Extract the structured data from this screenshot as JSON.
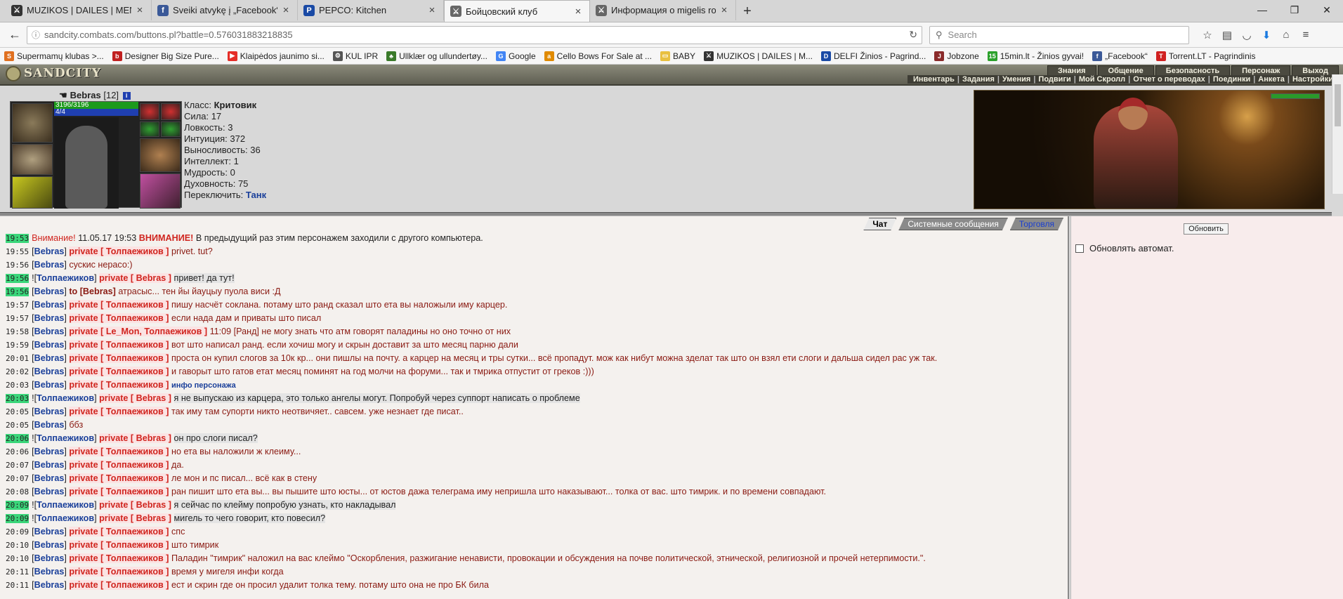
{
  "browser": {
    "tabs": [
      {
        "title": "MUZIKOS | DAILES | MENO |",
        "color": "#333333",
        "glyph": "⚔"
      },
      {
        "title": "Sveiki atvykę į „Facebook“ -",
        "color": "#3b5998",
        "glyph": "f"
      },
      {
        "title": "PEPCO: Kitchen",
        "color": "#1a4aa5",
        "glyph": "P"
      },
      {
        "title": "Бойцовский клуб",
        "color": "#666666",
        "glyph": "⚔"
      },
      {
        "title": "Информация о migelis role",
        "color": "#666666",
        "glyph": "⚔"
      }
    ],
    "url": "sandcity.combats.com/buttons.pl?battle=0.576031883218835",
    "search_placeholder": "Search",
    "bookmarks": [
      {
        "label": "Supermamų klubas >...",
        "color": "#e07020",
        "glyph": "S"
      },
      {
        "label": "Designer Big Size Pure...",
        "color": "#c02020",
        "glyph": "b"
      },
      {
        "label": "Klaipėdos jaunimo si...",
        "color": "#e52d27",
        "glyph": "▶"
      },
      {
        "label": "KUL IPR",
        "color": "#555555",
        "glyph": "⚙"
      },
      {
        "label": "Ullklær og ullundertøy...",
        "color": "#3a7a2a",
        "glyph": "♣"
      },
      {
        "label": "Google",
        "color": "#4285f4",
        "glyph": "G"
      },
      {
        "label": "Cello Bows For Sale at ...",
        "color": "#e08a00",
        "glyph": "a"
      },
      {
        "label": "BABY",
        "color": "#e8c040",
        "glyph": "▭"
      },
      {
        "label": "MUZIKOS | DAILES | M...",
        "color": "#333333",
        "glyph": "⚔"
      },
      {
        "label": "DELFI Žinios - Pagrind...",
        "color": "#1a4aa5",
        "glyph": "D"
      },
      {
        "label": "Jobzone",
        "color": "#8a2a2a",
        "glyph": "J"
      },
      {
        "label": "15min.lt - Žinios gyvai!",
        "color": "#2aa02a",
        "glyph": "15"
      },
      {
        "label": "„Facebook“",
        "color": "#3b5998",
        "glyph": "f"
      },
      {
        "label": "Torrent.LT - Pagrindinis",
        "color": "#d02020",
        "glyph": "T"
      }
    ]
  },
  "game": {
    "logo": "SANDCITY",
    "menu": [
      "Знания",
      "Общение",
      "Безопасность",
      "Персонаж",
      "Выход"
    ],
    "submenu": [
      "Инвентарь",
      "Задания",
      "Умения",
      "Подвиги",
      "Мой Скролл",
      "Отчет о переводах",
      "Поединки",
      "Анкета",
      "Настройки"
    ],
    "character": {
      "name": "Bebras",
      "level": "[12]",
      "hp": "3196/3196",
      "mana": "4/4",
      "class_label": "Класс:",
      "class_value": "Критовик",
      "stats": [
        {
          "label": "Сила:",
          "value": "17"
        },
        {
          "label": "Ловкость:",
          "value": "3"
        },
        {
          "label": "Интуиция:",
          "value": "372"
        },
        {
          "label": "Выносливость:",
          "value": "36"
        },
        {
          "label": "Интеллект:",
          "value": "1"
        },
        {
          "label": "Мудрость:",
          "value": "0"
        },
        {
          "label": "Духовность:",
          "value": "75"
        }
      ],
      "switch_label": "Переключить:",
      "switch_value": "Танк"
    },
    "chat_tabs": [
      "Чат",
      "Системные сообщения",
      "Торговля"
    ],
    "side": {
      "refresh": "Обновить",
      "auto_refresh": "Обновлять автомат."
    },
    "chat": [
      {
        "time": "19:53",
        "hl": true,
        "prefix": "",
        "sender": "",
        "channel": "",
        "warning": true,
        "text": "11.05.17 19:53",
        "bold": "ВНИМАНИЕ!",
        "rest": "В предыдущий раз этим персонажем заходили с другого компьютера.",
        "label": "Внимание!"
      },
      {
        "time": "19:55",
        "hl": false,
        "prefix": "",
        "sender": "Bebras",
        "channel": "private [ Толпаежиков ]",
        "text": "privet. tut?"
      },
      {
        "time": "19:56",
        "hl": false,
        "prefix": "",
        "sender": "Bebras",
        "channel": "",
        "text": "сускис нерасо:)"
      },
      {
        "time": "19:56",
        "hl": true,
        "prefix": "!",
        "sender": "Толпаежиков",
        "channel": "private [ Bebras ]",
        "text": "привет! да тут!",
        "self": true
      },
      {
        "time": "19:56",
        "hl": true,
        "prefix": "",
        "sender": "Bebras",
        "channel": "",
        "to": "to [Bebras]",
        "text": "атрасыс... тен йы йауцыу пуола виси :Д"
      },
      {
        "time": "19:57",
        "hl": false,
        "prefix": "",
        "sender": "Bebras",
        "channel": "private [ Толпаежиков ]",
        "text": "пишу насчёт соклана. потаму што ранд сказал што ета вы наложыли иму карцер."
      },
      {
        "time": "19:57",
        "hl": false,
        "prefix": "",
        "sender": "Bebras",
        "channel": "private [ Толпаежиков ]",
        "text": "если нада дам и приваты што писал"
      },
      {
        "time": "19:58",
        "hl": false,
        "prefix": "",
        "sender": "Bebras",
        "channel": "private [ Le_Mon, Толпаежиков ]",
        "text": "11:09 [Ранд] не могу знать что атм говорят паладины но оно точно от них"
      },
      {
        "time": "19:59",
        "hl": false,
        "prefix": "",
        "sender": "Bebras",
        "channel": "private [ Толпаежиков ]",
        "text": "вот што написал ранд. если хочиш могу и скрын доставит за што месяц парню дали"
      },
      {
        "time": "20:01",
        "hl": false,
        "prefix": "",
        "sender": "Bebras",
        "channel": "private [ Толпаежиков ]",
        "text": "проста он купил слогов за 10к кр... они пишлы на почту. а карцер на месяц и тры сутки... всё пропадут. мож как нибут можна зделат так што он взял ети слоги и дальша сидел рас уж так.",
        "wrap": true
      },
      {
        "time": "20:02",
        "hl": false,
        "prefix": "",
        "sender": "Bebras",
        "channel": "private [ Толпаежиков ]",
        "text": "и гаворыт што гатов етат месяц поминят на год молчи на форуми... так и тмрика отпустит от греков :)))"
      },
      {
        "time": "20:03",
        "hl": false,
        "prefix": "",
        "sender": "Bebras",
        "channel": "private [ Толпаежиков ]",
        "text": "",
        "info": "инфо персонажа"
      },
      {
        "time": "20:03",
        "hl": true,
        "prefix": "!",
        "sender": "Толпаежиков",
        "channel": "private [ Bebras ]",
        "text": "я не выпускаю из карцера, это только ангелы могут. Попробуй через суппорт написать о проблеме",
        "self": true
      },
      {
        "time": "20:05",
        "hl": false,
        "prefix": "",
        "sender": "Bebras",
        "channel": "private [ Толпаежиков ]",
        "text": "так иму там супорти никто неотвичяет.. савсем. уже незнает где писат.."
      },
      {
        "time": "20:05",
        "hl": false,
        "prefix": "",
        "sender": "Bebras",
        "channel": "",
        "text": "ббз"
      },
      {
        "time": "20:06",
        "hl": true,
        "prefix": "!",
        "sender": "Толпаежиков",
        "channel": "private [ Bebras ]",
        "text": "он про слоги писал?",
        "self": true
      },
      {
        "time": "20:06",
        "hl": false,
        "prefix": "",
        "sender": "Bebras",
        "channel": "private [ Толпаежиков ]",
        "text": "но ета вы наложили ж клеиму..."
      },
      {
        "time": "20:07",
        "hl": false,
        "prefix": "",
        "sender": "Bebras",
        "channel": "private [ Толпаежиков ]",
        "text": "да."
      },
      {
        "time": "20:07",
        "hl": false,
        "prefix": "",
        "sender": "Bebras",
        "channel": "private [ Толпаежиков ]",
        "text": "ле мон и пс писал... всё как в стену"
      },
      {
        "time": "20:08",
        "hl": false,
        "prefix": "",
        "sender": "Bebras",
        "channel": "private [ Толпаежиков ]",
        "text": "ран пишит што ета вы... вы пышите што юсты... от юстов дажа телеграма иму непришла што наказывают... толка от вас. што тимрик. и по времени совпадают."
      },
      {
        "time": "20:09",
        "hl": true,
        "prefix": "!",
        "sender": "Толпаежиков",
        "channel": "private [ Bebras ]",
        "text": "я сейчас по клейму попробую узнать, кто накладывал",
        "self": true
      },
      {
        "time": "20:09",
        "hl": true,
        "prefix": "!",
        "sender": "Толпаежиков",
        "channel": "private [ Bebras ]",
        "text": "мигель то чего говорит, кто повесил?",
        "self": true
      },
      {
        "time": "20:09",
        "hl": false,
        "prefix": "",
        "sender": "Bebras",
        "channel": "private [ Толпаежиков ]",
        "text": "спс"
      },
      {
        "time": "20:10",
        "hl": false,
        "prefix": "",
        "sender": "Bebras",
        "channel": "private [ Толпаежиков ]",
        "text": "што тимрик"
      },
      {
        "time": "20:10",
        "hl": false,
        "prefix": "",
        "sender": "Bebras",
        "channel": "private [ Толпаежиков ]",
        "text": "Паладин \"тимрик\" наложил на вас клеймо \"Оскорбления, разжигание ненависти, провокации и обсуждения на почве политической, этнической, религиозной и прочей нетерпимости.\".",
        "wrap": true
      },
      {
        "time": "20:11",
        "hl": false,
        "prefix": "",
        "sender": "Bebras",
        "channel": "private [ Толпаежиков ]",
        "text": "время у мигеля инфи когда"
      },
      {
        "time": "20:11",
        "hl": false,
        "prefix": "",
        "sender": "Bebras",
        "channel": "private [ Толпаежиков ]",
        "text": "ест и скрин где он просил удалит толка тему. потаму што она не про БК била"
      }
    ]
  }
}
